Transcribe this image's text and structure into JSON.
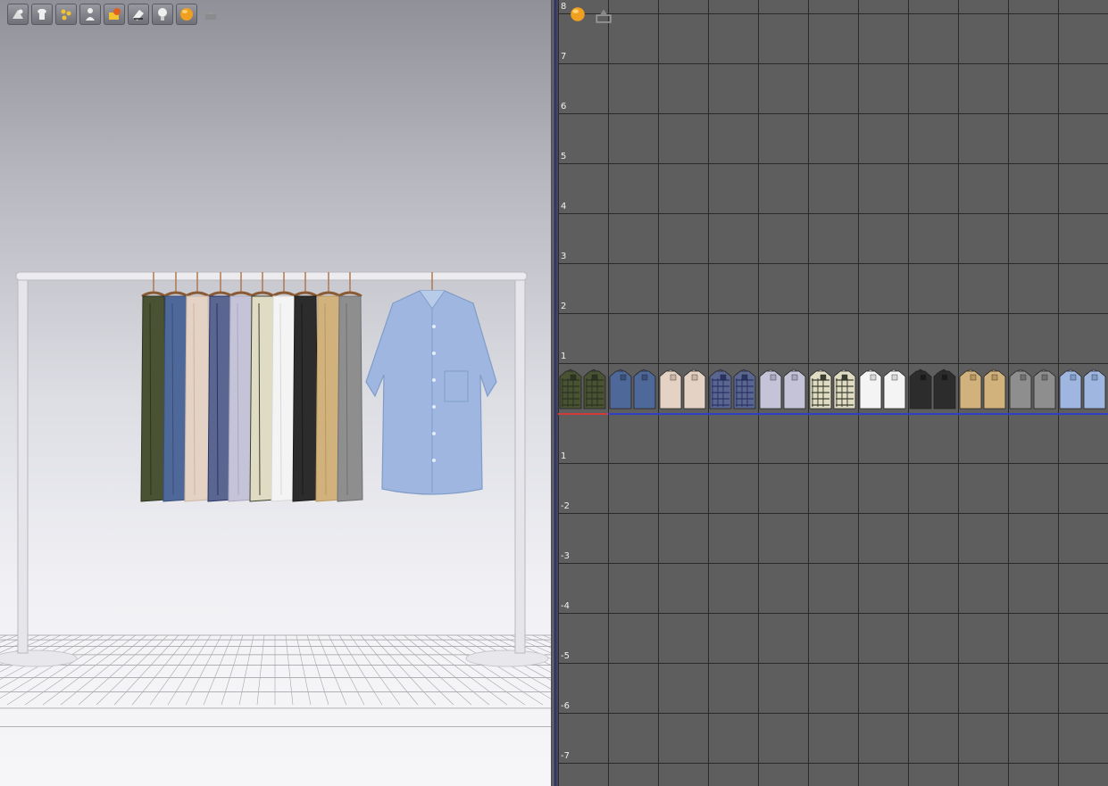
{
  "viewport_toolbar": {
    "tools": [
      {
        "name": "show-avatar-icon"
      },
      {
        "name": "show-garment-icon"
      },
      {
        "name": "show-pins-icon"
      },
      {
        "name": "show-avatar-silhouette-icon"
      },
      {
        "name": "texture-surface-icon"
      },
      {
        "name": "mesh-view-icon"
      },
      {
        "name": "light-bulb-icon"
      },
      {
        "name": "render-sphere-icon"
      },
      {
        "name": "snapshot-icon",
        "disabled": true
      }
    ]
  },
  "pattern_window": {
    "y_axis_labels": [
      "8",
      "7",
      "6",
      "5",
      "4",
      "3",
      "2",
      "1",
      "1",
      "-2",
      "-3",
      "-4",
      "-5",
      "-6",
      "-7"
    ],
    "toolbar": [
      {
        "name": "render-sphere-icon"
      },
      {
        "name": "pattern-view-icon"
      }
    ],
    "colors": {
      "selection_red": "#d33a3a",
      "selection_blue": "#2f3fc8",
      "grid_bg": "#5e5e5e"
    }
  },
  "garments": [
    {
      "name": "olive-plaid-shirt",
      "color": "#4a5234",
      "accent": "#2c3320",
      "pattern": "plaid"
    },
    {
      "name": "navy-chambray-shirt",
      "color": "#4f689a",
      "accent": "#3a4f7a",
      "pattern": "solid"
    },
    {
      "name": "beige-shirt",
      "color": "#e4d2c4",
      "accent": "#cbb6a6",
      "pattern": "solid"
    },
    {
      "name": "blue-gingham-shirt",
      "color": "#5a6690",
      "accent": "#2a3366",
      "pattern": "check"
    },
    {
      "name": "lavender-shirt",
      "color": "#c4c3d8",
      "accent": "#a9a8c0",
      "pattern": "solid"
    },
    {
      "name": "palm-print-shirt",
      "color": "#e0dcc4",
      "accent": "#3c4030",
      "pattern": "leaf"
    },
    {
      "name": "white-shirt",
      "color": "#f4f4f4",
      "accent": "#d8d8d8",
      "pattern": "solid"
    },
    {
      "name": "black-shirt",
      "color": "#2c2c2c",
      "accent": "#1a1a1a",
      "pattern": "solid"
    },
    {
      "name": "khaki-shirt",
      "color": "#d2b27c",
      "accent": "#b99860",
      "pattern": "solid"
    },
    {
      "name": "grey-shirt",
      "color": "#8e8e8e",
      "accent": "#707070",
      "pattern": "solid"
    },
    {
      "name": "light-blue-shirt",
      "color": "#9fb7e0",
      "accent": "#7f9cc8",
      "pattern": "solid"
    }
  ]
}
